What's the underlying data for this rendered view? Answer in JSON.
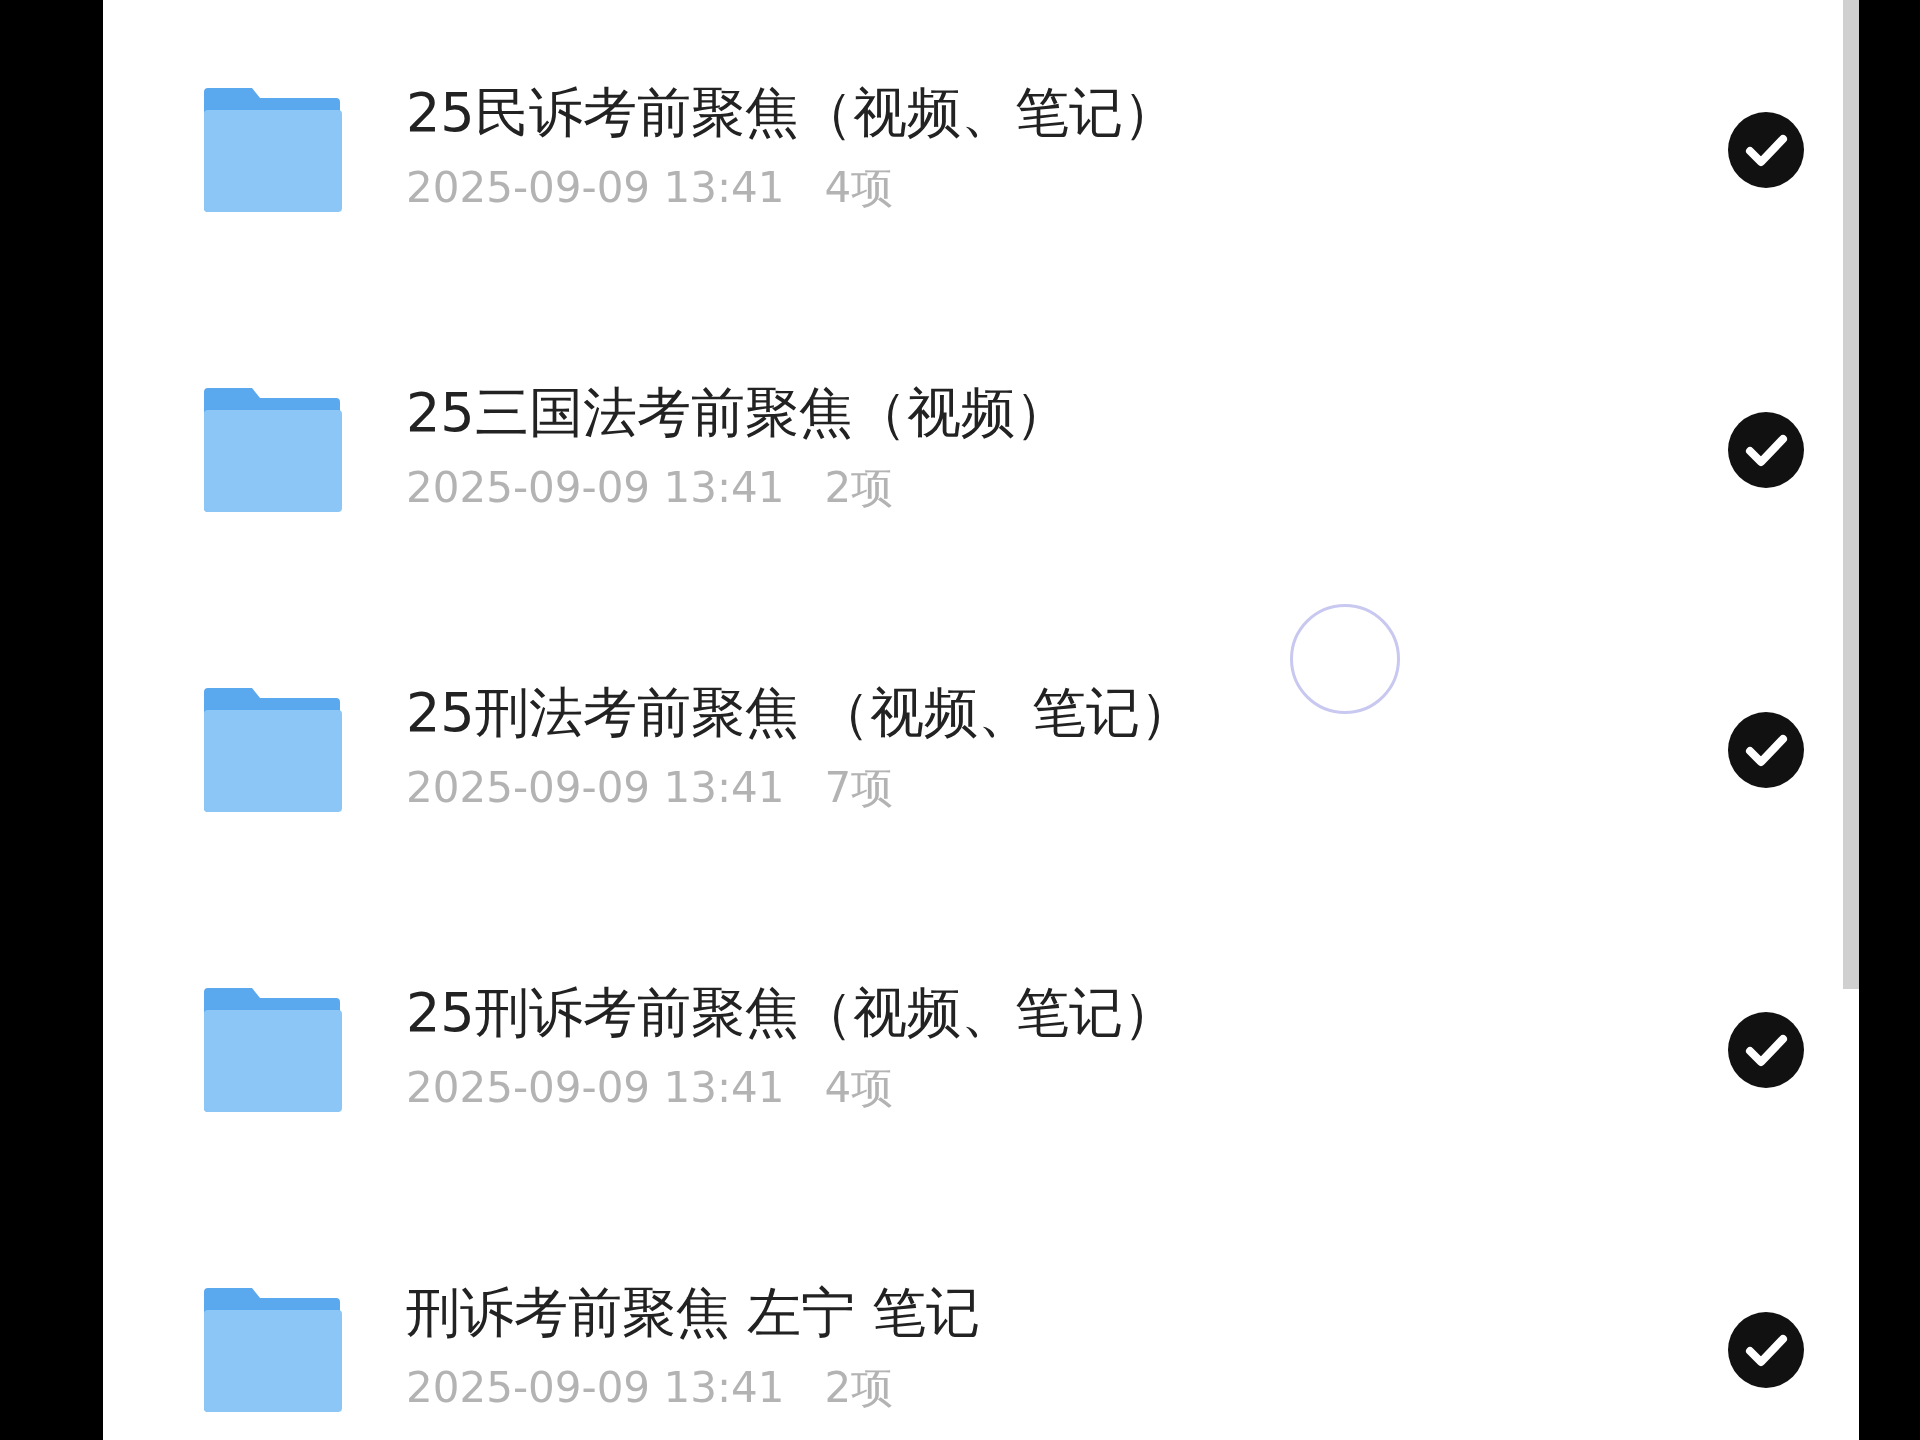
{
  "folders": [
    {
      "name": "25民诉考前聚焦（视频、笔记）",
      "date": "2025-09-09 13:41",
      "count": "4项",
      "selected": true
    },
    {
      "name": "25三国法考前聚焦（视频）",
      "date": "2025-09-09 13:41",
      "count": "2项",
      "selected": true
    },
    {
      "name": "25刑法考前聚焦 （视频、笔记）",
      "date": "2025-09-09 13:41",
      "count": "7项",
      "selected": true
    },
    {
      "name": "25刑诉考前聚焦（视频、笔记）",
      "date": "2025-09-09 13:41",
      "count": "4项",
      "selected": true
    },
    {
      "name": "刑诉考前聚焦 左宁 笔记",
      "date": "2025-09-09 13:41",
      "count": "2项",
      "selected": true
    }
  ]
}
